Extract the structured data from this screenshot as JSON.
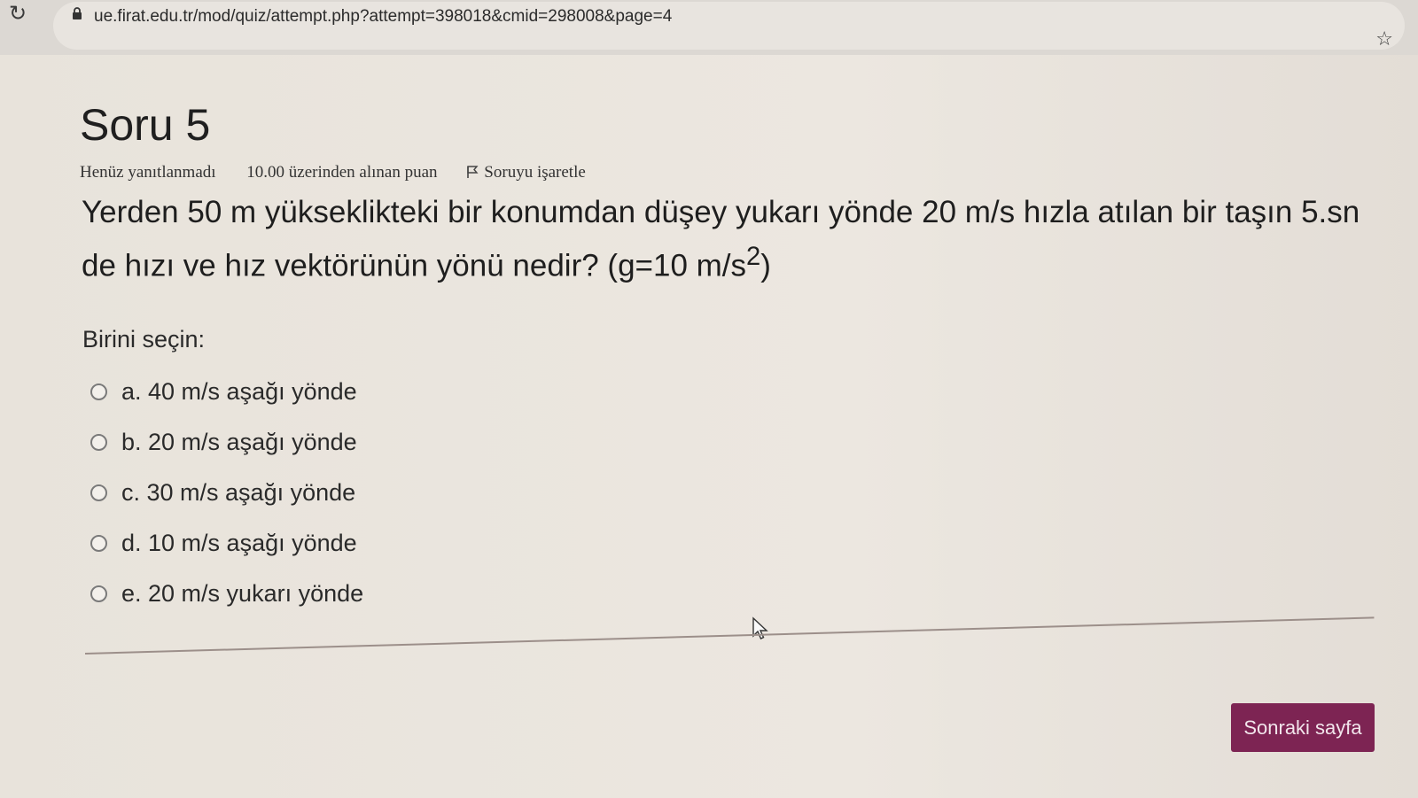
{
  "browser": {
    "url": "ue.firat.edu.tr/mod/quiz/attempt.php?attempt=398018&cmid=298008&page=4",
    "icons": [
      "reload-icon",
      "lock-icon",
      "star-icon"
    ]
  },
  "question": {
    "title": "Soru 5",
    "status": "Henüz yanıtlanmadı",
    "points": "10.00 üzerinden alınan puan",
    "flag_label": "Soruyu işaretle",
    "text_main": "Yerden 50 m yükseklikteki bir konumdan düşey yukarı yönde 20 m/s hızla atılan bir taşın 5.sn de hızı ve hız vektörünün yönü nedir? (g=10 m/s",
    "text_sup": "2",
    "text_end": ")",
    "prompt": "Birini seçin:",
    "options": [
      {
        "label": "a. 40 m/s aşağı yönde"
      },
      {
        "label": "b. 20 m/s aşağı yönde"
      },
      {
        "label": "c. 30 m/s aşağı yönde"
      },
      {
        "label": "d. 10 m/s aşağı yönde"
      },
      {
        "label": "e. 20 m/s yukarı yönde"
      }
    ]
  },
  "navigation": {
    "next_label": "Sonraki sayfa"
  },
  "colors": {
    "accent": "#7d2453"
  }
}
